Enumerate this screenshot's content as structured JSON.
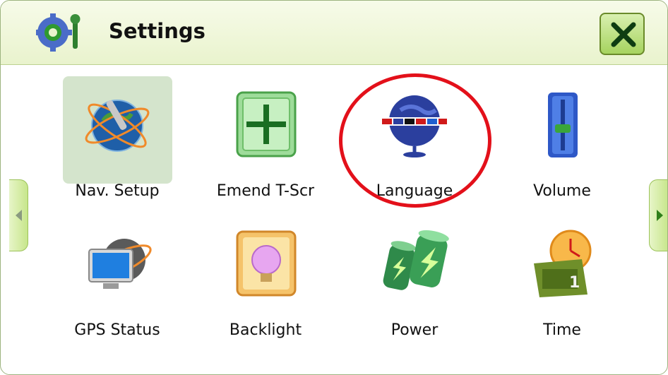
{
  "window": {
    "title": "Settings"
  },
  "menu": {
    "items": [
      {
        "label": "Nav. Setup",
        "icon": "globe-wrench-icon",
        "selected": true
      },
      {
        "label": "Emend T-Scr",
        "icon": "crosshair-icon"
      },
      {
        "label": "Language",
        "icon": "globe-flags-icon"
      },
      {
        "label": "Volume",
        "icon": "volume-slider-icon"
      },
      {
        "label": "GPS Status",
        "icon": "gps-monitor-icon"
      },
      {
        "label": "Backlight",
        "icon": "lightbulb-icon"
      },
      {
        "label": "Power",
        "icon": "battery-icon"
      },
      {
        "label": "Time",
        "icon": "clock-calendar-icon"
      }
    ]
  },
  "navigation": {
    "prev_icon": "arrow-left-icon",
    "next_icon": "arrow-right-icon"
  },
  "colors": {
    "accent": "#a6d35f",
    "highlight_circle": "#e3101a",
    "titlebar": "#e9f3cd"
  }
}
